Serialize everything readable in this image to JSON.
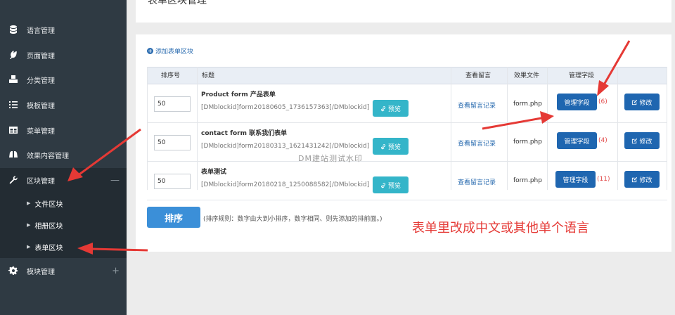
{
  "sidebar": {
    "items": [
      {
        "label": "语言管理",
        "icon": "database-icon"
      },
      {
        "label": "页面管理",
        "icon": "leaf-icon"
      },
      {
        "label": "分类管理",
        "icon": "cubes-icon"
      },
      {
        "label": "模板管理",
        "icon": "list-ordered-icon"
      },
      {
        "label": "菜单管理",
        "icon": "table-icon"
      },
      {
        "label": "效果内容管理",
        "icon": "binoculars-icon"
      },
      {
        "label": "区块管理",
        "icon": "wrench-icon",
        "toggle": "—"
      },
      {
        "label": "模块管理",
        "icon": "gear-icon",
        "toggle": "+"
      }
    ],
    "subitems": [
      "文件区块",
      "相册区块",
      "表单区块"
    ]
  },
  "page": {
    "title": "表单区块管理",
    "add_link": "添加表单区块"
  },
  "table": {
    "headers": [
      "排序号",
      "标题",
      "查看留言",
      "效果文件",
      "管理字段"
    ],
    "rows": [
      {
        "order": "50",
        "title": "Product form 产品表单",
        "code": "[DMblockid]form20180605_1736157363[/DMblockid]",
        "preview": "预览",
        "messages": "查看留言记录",
        "file": "form.php",
        "field_btn": "管理字段",
        "count": "(6)",
        "edit": "修改"
      },
      {
        "order": "50",
        "title": "contact form 联系我们表单",
        "code": "[DMblockid]form20180313_1621431242[/DMblockid]",
        "preview": "预览",
        "messages": "查看留言记录",
        "file": "form.php",
        "field_btn": "管理字段",
        "count": "(4)",
        "edit": "修改"
      },
      {
        "order": "50",
        "title": "表单测试",
        "code": "[DMblockid]form20180218_1250088582[/DMblockid]",
        "preview": "预览",
        "messages": "查看留言记录",
        "file": "form.php",
        "field_btn": "管理字段",
        "count": "(11)",
        "edit": "修改"
      }
    ]
  },
  "footer": {
    "sort_button": "排序",
    "sort_note": "(排序规则：数字由大到小排序，数字相同、则先添加的排前面。)"
  },
  "annotation_text": "表单里改成中文或其他单个语言",
  "watermark": "DM建站测试水印",
  "colors": {
    "sidebar": "#2f3a43",
    "primary": "#1f66b0",
    "preview": "#34b5c9",
    "arrow": "#e53935"
  }
}
